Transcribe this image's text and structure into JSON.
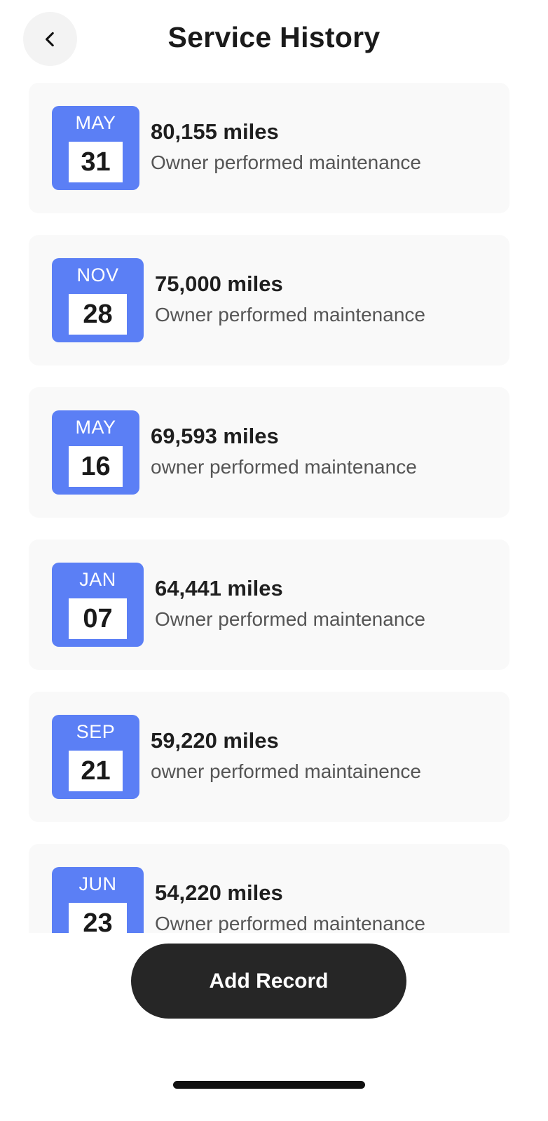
{
  "header": {
    "title": "Service History",
    "back_icon": "chevron-left-icon"
  },
  "records": [
    {
      "month": "MAY",
      "day": "31",
      "miles": "80,155 miles",
      "description": "Owner performed maintenance"
    },
    {
      "month": "NOV",
      "day": "28",
      "miles": "75,000 miles",
      "description": "Owner performed maintenance"
    },
    {
      "month": "MAY",
      "day": "16",
      "miles": "69,593 miles",
      "description": "owner performed maintenance"
    },
    {
      "month": "JAN",
      "day": "07",
      "miles": "64,441 miles",
      "description": "Owner performed maintenance"
    },
    {
      "month": "SEP",
      "day": "21",
      "miles": "59,220 miles",
      "description": "owner performed maintainence"
    },
    {
      "month": "JUN",
      "day": "23",
      "miles": "54,220 miles",
      "description": "Owner performed maintenance"
    }
  ],
  "footer": {
    "add_record_label": "Add Record"
  },
  "colors": {
    "badge_blue": "#5b7ff5",
    "card_bg": "#f9f9f9",
    "button_dark": "#262626"
  }
}
